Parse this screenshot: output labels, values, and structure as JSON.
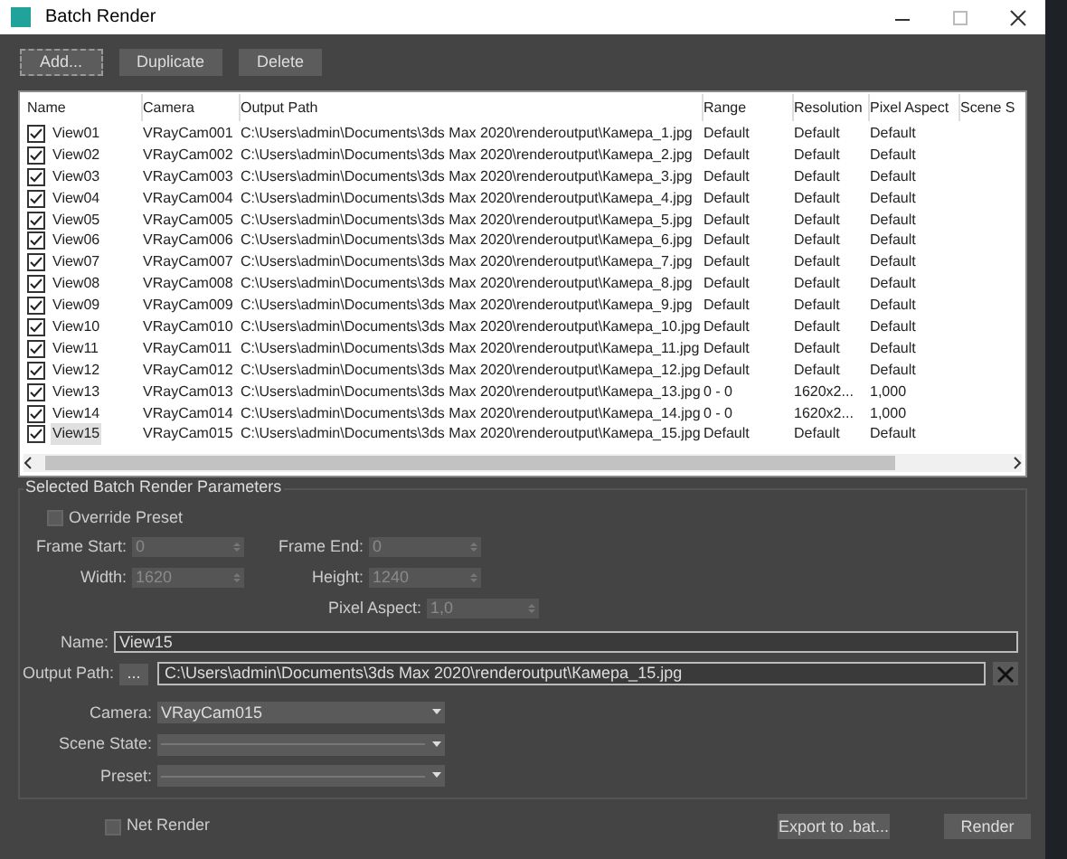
{
  "window": {
    "title": "Batch Render"
  },
  "toolbar_buttons": [
    "Add...",
    "Duplicate",
    "Delete"
  ],
  "table": {
    "columns": [
      "Name",
      "Camera",
      "Output Path",
      "Range",
      "Resolution",
      "Pixel Aspect",
      "Scene S"
    ],
    "rows": [
      {
        "checked": true,
        "selected": false,
        "name": "View01",
        "camera": "VRayCam001",
        "output_path": "C:\\Users\\admin\\Documents\\3ds Max 2020\\renderoutput\\Камера_1.jpg",
        "range": "Default",
        "resolution": "Default",
        "pixel_aspect": "Default"
      },
      {
        "checked": true,
        "selected": false,
        "name": "View02",
        "camera": "VRayCam002",
        "output_path": "C:\\Users\\admin\\Documents\\3ds Max 2020\\renderoutput\\Камера_2.jpg",
        "range": "Default",
        "resolution": "Default",
        "pixel_aspect": "Default"
      },
      {
        "checked": true,
        "selected": false,
        "name": "View03",
        "camera": "VRayCam003",
        "output_path": "C:\\Users\\admin\\Documents\\3ds Max 2020\\renderoutput\\Камера_3.jpg",
        "range": "Default",
        "resolution": "Default",
        "pixel_aspect": "Default"
      },
      {
        "checked": true,
        "selected": false,
        "name": "View04",
        "camera": "VRayCam004",
        "output_path": "C:\\Users\\admin\\Documents\\3ds Max 2020\\renderoutput\\Камера_4.jpg",
        "range": "Default",
        "resolution": "Default",
        "pixel_aspect": "Default"
      },
      {
        "checked": true,
        "selected": false,
        "name": "View05",
        "camera": "VRayCam005",
        "output_path": "C:\\Users\\admin\\Documents\\3ds Max 2020\\renderoutput\\Камера_5.jpg",
        "range": "Default",
        "resolution": "Default",
        "pixel_aspect": "Default"
      },
      {
        "checked": true,
        "selected": false,
        "name": "View06",
        "camera": "VRayCam006",
        "output_path": "C:\\Users\\admin\\Documents\\3ds Max 2020\\renderoutput\\Камера_6.jpg",
        "range": "Default",
        "resolution": "Default",
        "pixel_aspect": "Default"
      },
      {
        "checked": true,
        "selected": false,
        "name": "View07",
        "camera": "VRayCam007",
        "output_path": "C:\\Users\\admin\\Documents\\3ds Max 2020\\renderoutput\\Камера_7.jpg",
        "range": "Default",
        "resolution": "Default",
        "pixel_aspect": "Default"
      },
      {
        "checked": true,
        "selected": false,
        "name": "View08",
        "camera": "VRayCam008",
        "output_path": "C:\\Users\\admin\\Documents\\3ds Max 2020\\renderoutput\\Камера_8.jpg",
        "range": "Default",
        "resolution": "Default",
        "pixel_aspect": "Default"
      },
      {
        "checked": true,
        "selected": false,
        "name": "View09",
        "camera": "VRayCam009",
        "output_path": "C:\\Users\\admin\\Documents\\3ds Max 2020\\renderoutput\\Камера_9.jpg",
        "range": "Default",
        "resolution": "Default",
        "pixel_aspect": "Default"
      },
      {
        "checked": true,
        "selected": false,
        "name": "View10",
        "camera": "VRayCam010",
        "output_path": "C:\\Users\\admin\\Documents\\3ds Max 2020\\renderoutput\\Камера_10.jpg",
        "range": "Default",
        "resolution": "Default",
        "pixel_aspect": "Default"
      },
      {
        "checked": true,
        "selected": false,
        "name": "View11",
        "camera": "VRayCam011",
        "output_path": "C:\\Users\\admin\\Documents\\3ds Max 2020\\renderoutput\\Камера_11.jpg",
        "range": "Default",
        "resolution": "Default",
        "pixel_aspect": "Default"
      },
      {
        "checked": true,
        "selected": false,
        "name": "View12",
        "camera": "VRayCam012",
        "output_path": "C:\\Users\\admin\\Documents\\3ds Max 2020\\renderoutput\\Камера_12.jpg",
        "range": "Default",
        "resolution": "Default",
        "pixel_aspect": "Default"
      },
      {
        "checked": true,
        "selected": false,
        "name": "View13",
        "camera": "VRayCam013",
        "output_path": "C:\\Users\\admin\\Documents\\3ds Max 2020\\renderoutput\\Камера_13.jpg",
        "range": "0 - 0",
        "resolution": "1620x2...",
        "pixel_aspect": "1,000"
      },
      {
        "checked": true,
        "selected": false,
        "name": "View14",
        "camera": "VRayCam014",
        "output_path": "C:\\Users\\admin\\Documents\\3ds Max 2020\\renderoutput\\Камера_14.jpg",
        "range": "0 - 0",
        "resolution": "1620x2...",
        "pixel_aspect": "1,000"
      },
      {
        "checked": true,
        "selected": true,
        "name": "View15",
        "camera": "VRayCam015",
        "output_path": "C:\\Users\\admin\\Documents\\3ds Max 2020\\renderoutput\\Камера_15.jpg",
        "range": "Default",
        "resolution": "Default",
        "pixel_aspect": "Default"
      }
    ]
  },
  "parameters": {
    "title": "Selected Batch Render Parameters",
    "override_preset": {
      "label": "Override Preset",
      "checked": false
    },
    "spinner_rows": [
      [
        {
          "label": "Frame Start:",
          "value": "0",
          "disabled": true
        },
        {
          "label": "Frame End:",
          "value": "0",
          "disabled": true
        }
      ],
      [
        {
          "label": "Width:",
          "value": "1620",
          "disabled": true
        },
        {
          "label": "Height:",
          "value": "1240",
          "disabled": true
        }
      ],
      [
        {
          "label": "Pixel Aspect:",
          "value": "1,0",
          "disabled": true
        }
      ]
    ],
    "name": {
      "label": "Name:",
      "value": "View15"
    },
    "output_path": {
      "label": "Output Path:",
      "browse": "...",
      "value": "C:\\Users\\admin\\Documents\\3ds Max 2020\\renderoutput\\Камера_15.jpg"
    },
    "dropdowns": [
      {
        "label": "Camera:",
        "value": "VRayCam015"
      },
      {
        "label": "Scene State:"
      },
      {
        "label": "Preset:"
      }
    ]
  },
  "footer": {
    "net_render": {
      "label": "Net Render",
      "checked": false
    },
    "buttons": [
      "Export to .bat...",
      "Render"
    ]
  }
}
